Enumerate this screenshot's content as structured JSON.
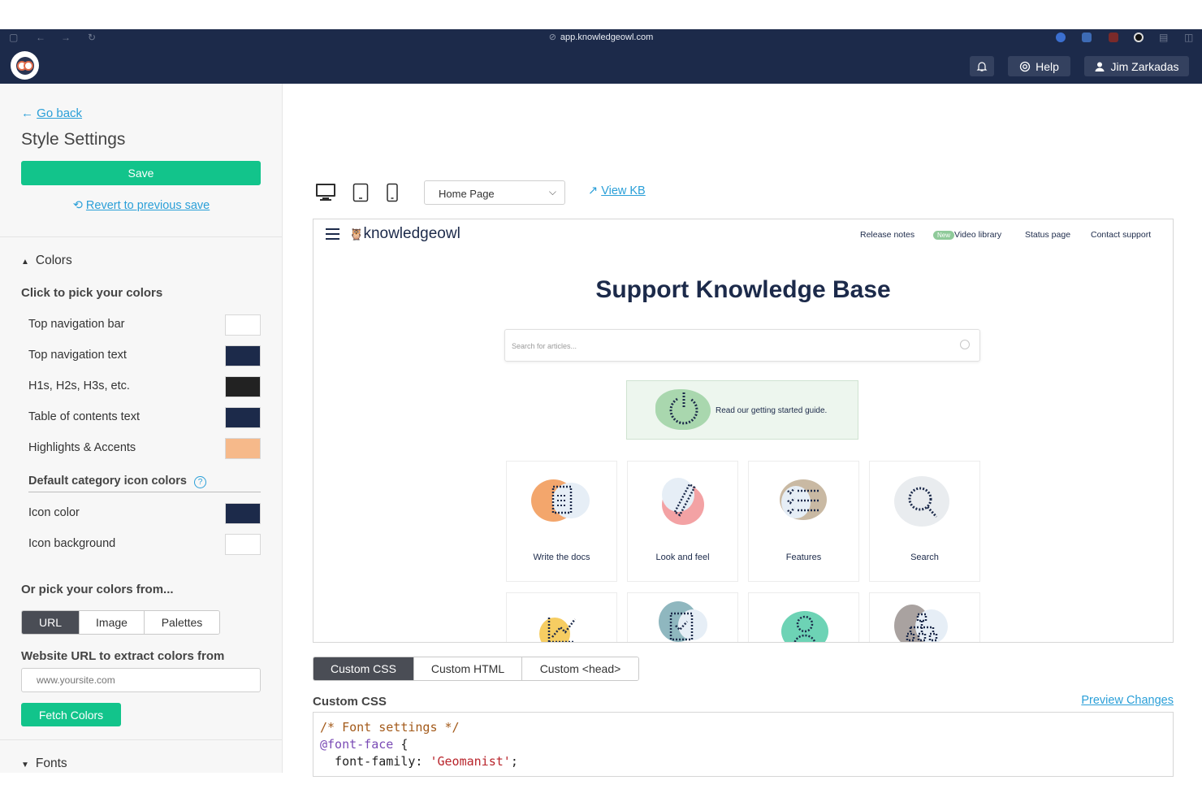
{
  "browser": {
    "url": "app.knowledgeowl.com"
  },
  "header": {
    "help_label": "Help",
    "user_name": "Jim Zarkadas"
  },
  "sidebar": {
    "go_back": "Go back",
    "title": "Style Settings",
    "save_label": "Save",
    "revert_label": "Revert to previous save",
    "colors_section": "Colors",
    "pick_heading": "Click to pick your colors",
    "color_rows": [
      {
        "label": "Top navigation bar",
        "color": "#ffffff"
      },
      {
        "label": "Top navigation text",
        "color": "#1c2a4a"
      },
      {
        "label": "H1s, H2s, H3s, etc.",
        "color": "#222222"
      },
      {
        "label": "Table of contents text",
        "color": "#1c2a4a"
      },
      {
        "label": "Highlights & Accents",
        "color": "#f6b98a"
      }
    ],
    "category_heading": "Default category icon colors",
    "icon_rows": [
      {
        "label": "Icon color",
        "color": "#1c2a4a"
      },
      {
        "label": "Icon background",
        "color": "#ffffff"
      }
    ],
    "or_pick_heading": "Or pick your colors from...",
    "source_tabs": [
      "URL",
      "Image",
      "Palettes"
    ],
    "url_label": "Website URL to extract colors from",
    "url_placeholder": "www.yoursite.com",
    "fetch_label": "Fetch Colors",
    "fonts_section": "Fonts"
  },
  "main": {
    "page_select": "Home Page",
    "view_kb": "View KB",
    "preview": {
      "brand": "knowledgeowl",
      "nav": [
        "Release notes",
        "Video library",
        "Status page",
        "Contact support"
      ],
      "new_badge": "New",
      "title": "Support Knowledge Base",
      "search_placeholder": "Search for articles...",
      "guide_text": "Read our getting started guide.",
      "cards": [
        "Write the docs",
        "Look and feel",
        "Features",
        "Search"
      ]
    },
    "code_tabs": [
      "Custom CSS",
      "Custom HTML",
      "Custom <head>"
    ],
    "custom_css_label": "Custom CSS",
    "preview_changes": "Preview Changes",
    "code": {
      "line1": "/* Font settings */",
      "line2_at": "@font-face",
      "line2_rest": " {",
      "line3_prop": "  font-family: ",
      "line3_val": "'Geomanist'",
      "line3_end": ";"
    }
  },
  "colors": {
    "navy": "#1c2a4a",
    "green": "#12c48b",
    "link": "#2a9fd8"
  }
}
